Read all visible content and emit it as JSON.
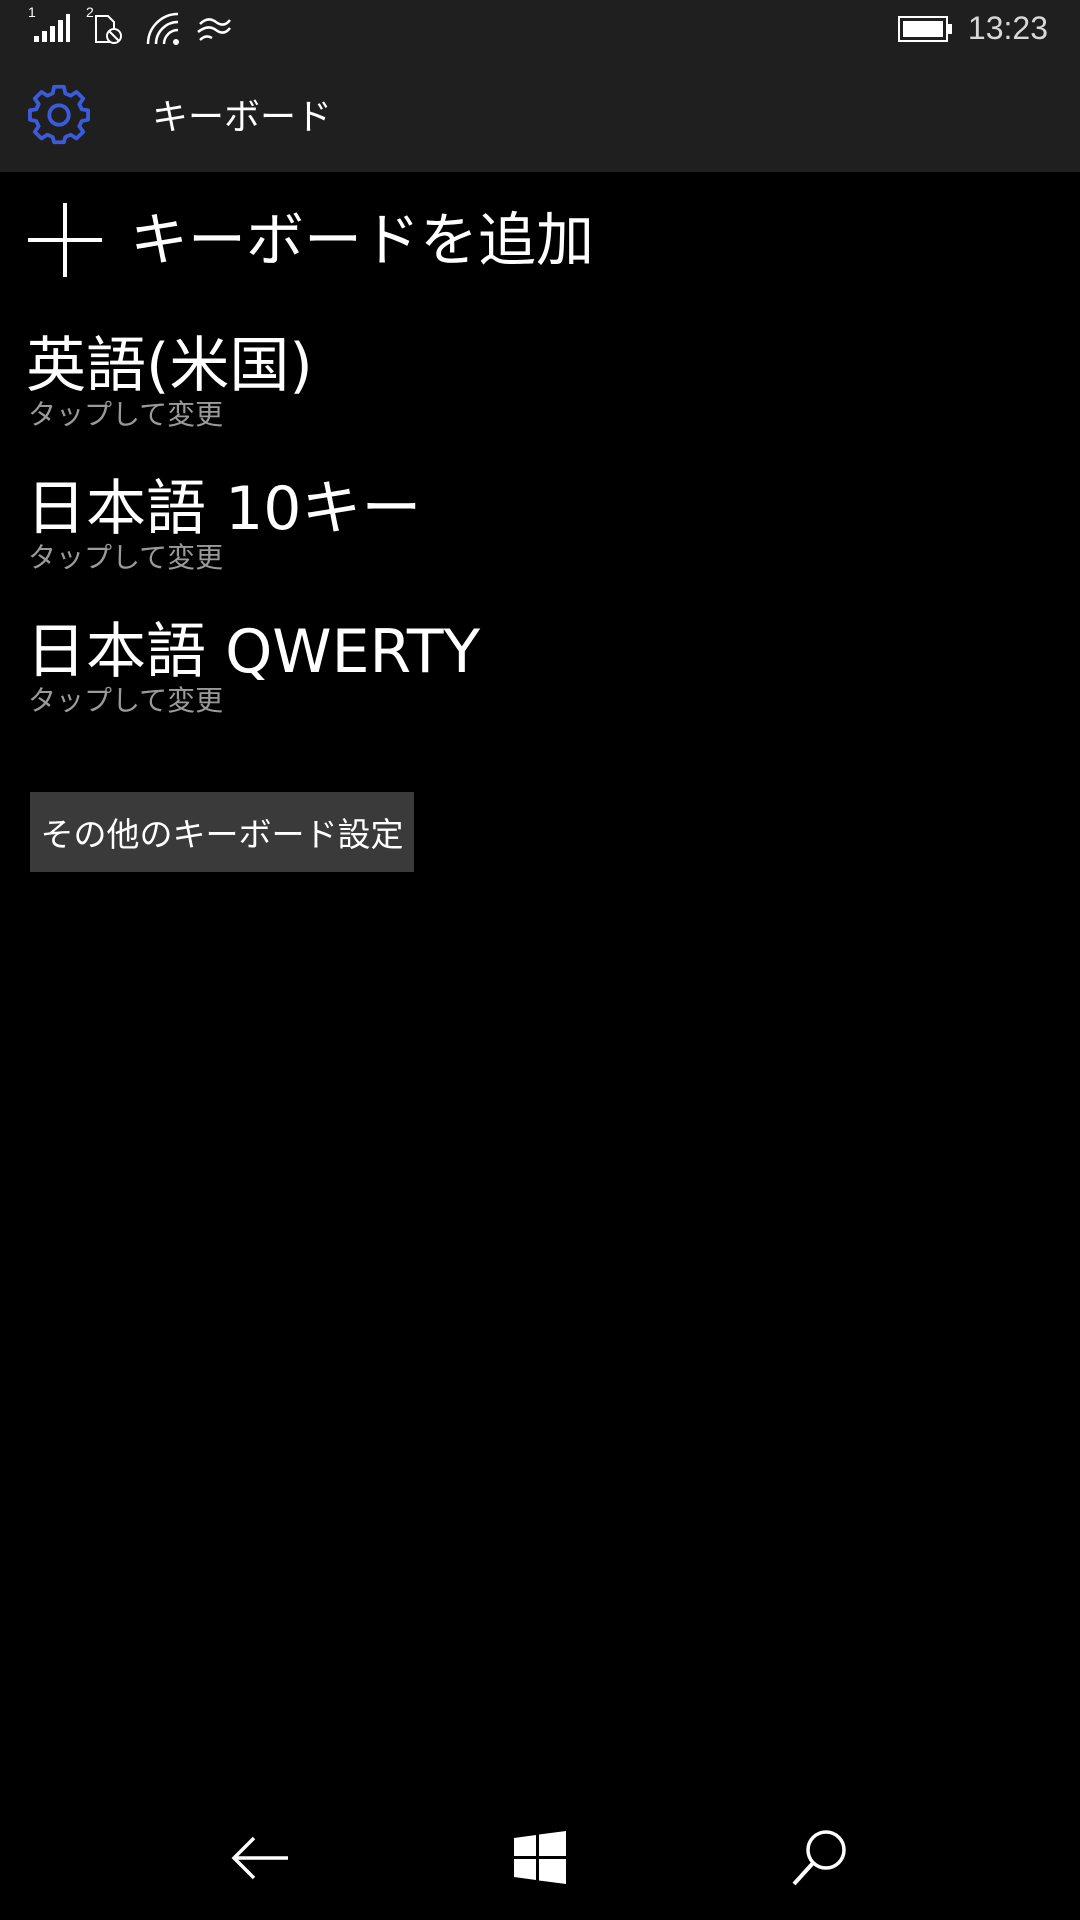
{
  "status_bar": {
    "sim1": "1",
    "sim2": "2",
    "time": "13:23",
    "icons": [
      "signal-icon",
      "sim-disabled-icon",
      "wifi-icon",
      "data-sense-icon",
      "battery-icon"
    ]
  },
  "header": {
    "title": "キーボード",
    "icon": "gear-icon",
    "accent_color": "#3b5bdb"
  },
  "add_keyboard": {
    "icon": "plus-icon",
    "label": "キーボードを追加"
  },
  "keyboards": [
    {
      "name": "英語(米国)",
      "subtitle": "タップして変更"
    },
    {
      "name": "日本語 10キー",
      "subtitle": "タップして変更"
    },
    {
      "name": "日本語 QWERTY",
      "subtitle": "タップして変更"
    }
  ],
  "more_settings_button": {
    "label": "その他のキーボード設定"
  },
  "nav_bar": {
    "buttons": [
      "back-icon",
      "windows-start-icon",
      "search-icon"
    ]
  }
}
